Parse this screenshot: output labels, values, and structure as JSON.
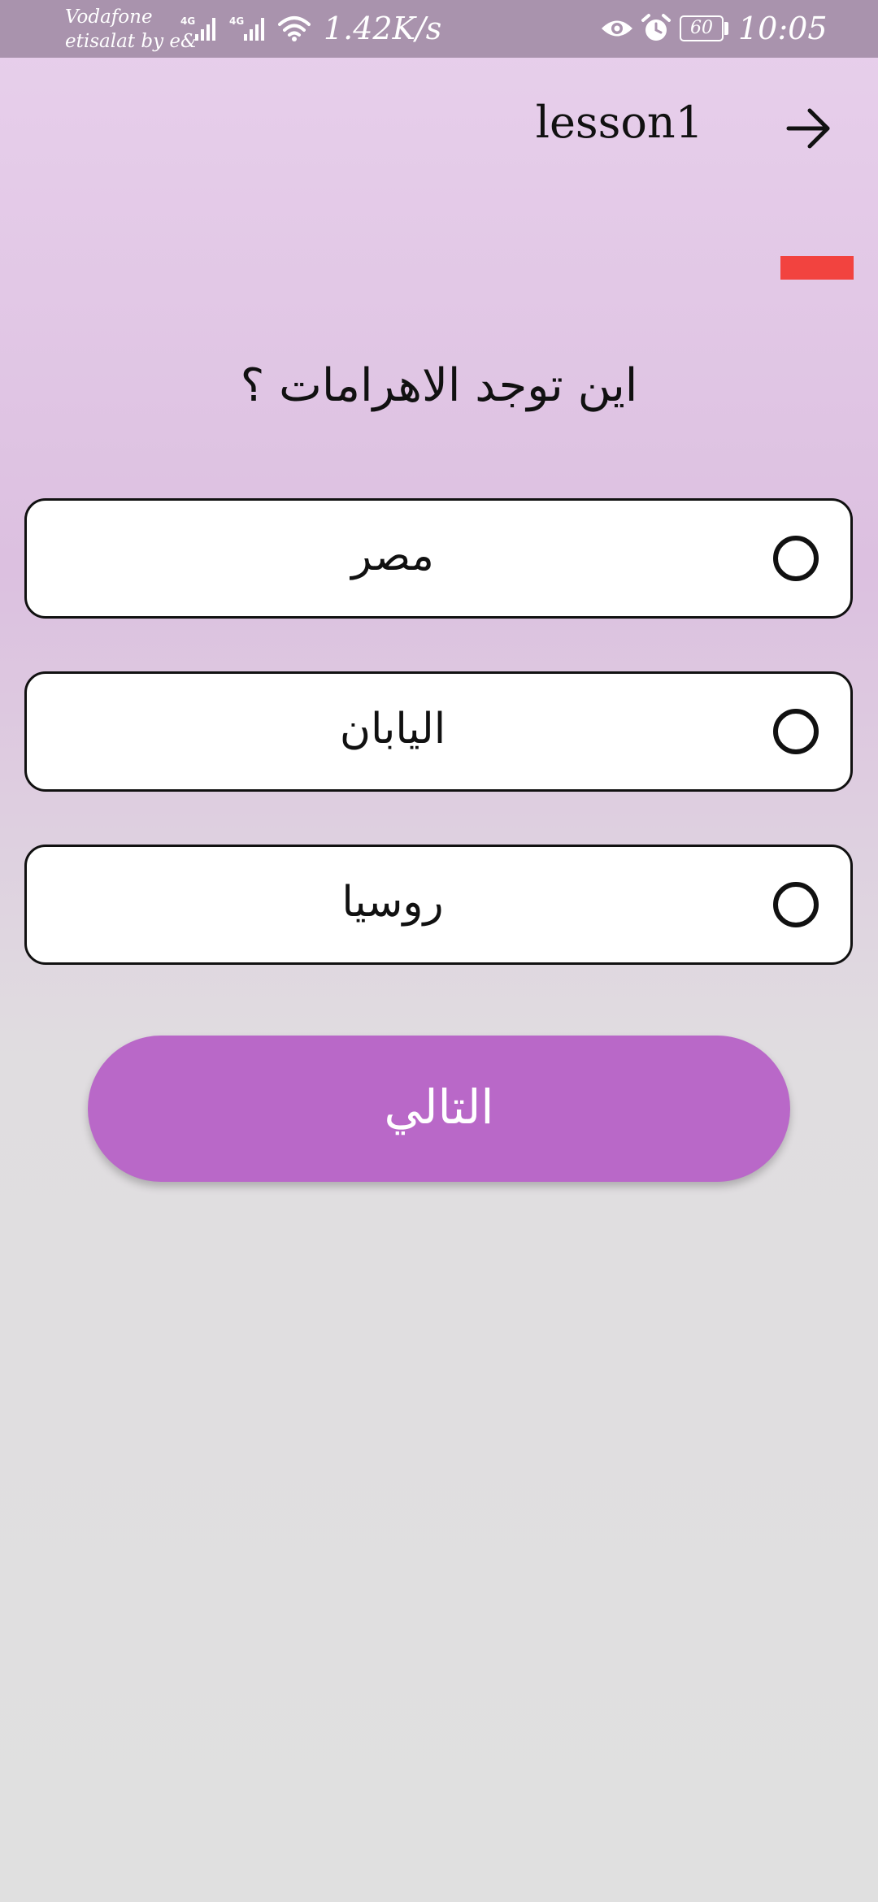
{
  "status_bar": {
    "carrier_1": "Vodafone",
    "carrier_2": "etisalat by e&",
    "network_1": "4G",
    "network_2": "4G",
    "net_speed": "1.42K/s",
    "battery": "60",
    "time": "10:05",
    "icons": [
      "signal-icon",
      "signal-icon",
      "wifi-icon",
      "eye-icon",
      "alarm-icon",
      "battery-icon"
    ]
  },
  "header": {
    "title": "lesson1",
    "back_icon": "arrow-right-icon"
  },
  "timer": {
    "color": "#f2433f"
  },
  "question": {
    "text": "اين توجد الاهرامات ؟"
  },
  "options": [
    {
      "label": "مصر",
      "selected": false
    },
    {
      "label": "اليابان",
      "selected": false
    },
    {
      "label": "روسيا",
      "selected": false
    }
  ],
  "next_button": {
    "label": "التالي",
    "color": "#b968c8"
  },
  "colors": {
    "status_bar_bg": "#a993ad",
    "background_top": "#e8d0ec",
    "background_bottom": "#e0e0e0",
    "accent": "#b968c8",
    "timer": "#f2433f"
  }
}
